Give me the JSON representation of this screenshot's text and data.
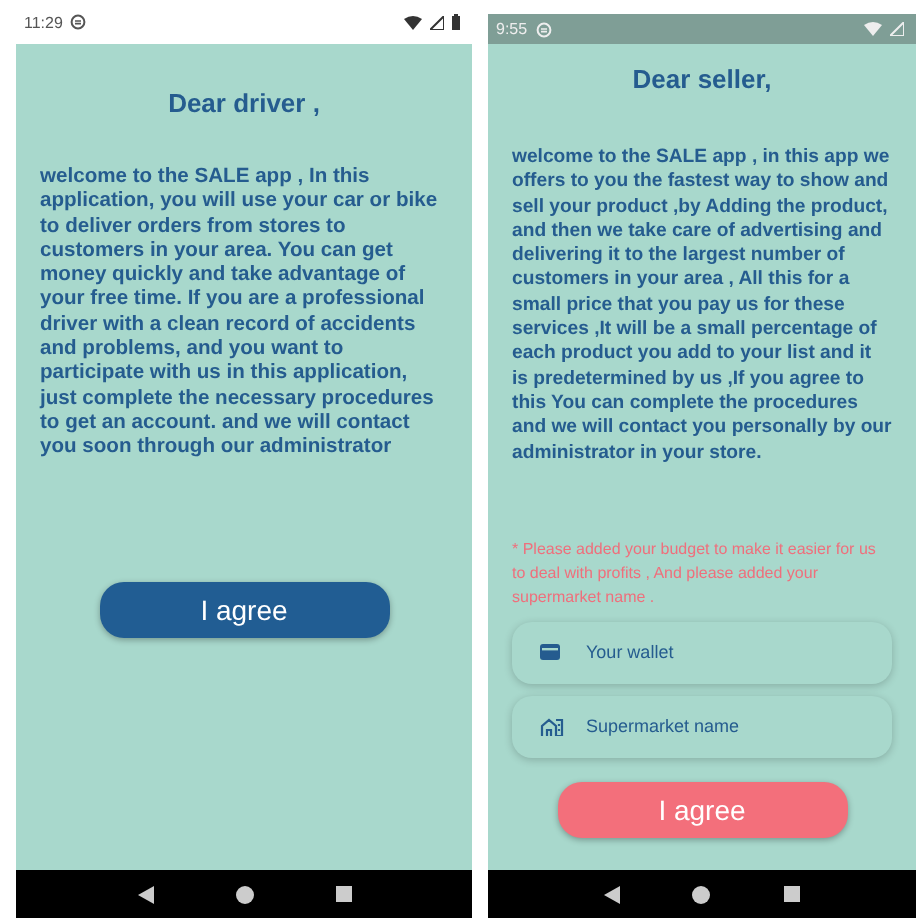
{
  "screens": [
    {
      "kind": "driver",
      "status_bar": {
        "time": "11:29"
      },
      "title": "Dear driver ,",
      "body": "welcome to the SALE app , In this application, you will use your car or bike to deliver orders from stores to customers in your area. You can get money quickly and take advantage of your free time. If you are a professional driver with a clean record of accidents and problems, and you want to participate with us in this application, just complete the necessary procedures to get an account. and we will contact you soon through our administrator",
      "button": "I agree"
    },
    {
      "kind": "seller",
      "status_bar": {
        "time": "9:55"
      },
      "title": "Dear seller,",
      "body": "welcome to the SALE app , in this app we offers to you the fastest way to show and sell your product ,by Adding the product, and then we take care of advertising and delivering it to the largest number of customers in your area , All this for a small price that you pay us for these services ,It will be a small percentage of each product you add to your list and it is predetermined by us ,If you agree to this You can complete the procedures and we will contact you personally by our administrator in your store.",
      "note": "* Please added your budget to make it easier for us to deal with profits , And please added your supermarket name .",
      "fields": [
        {
          "kind": "wallet",
          "placeholder": "Your wallet"
        },
        {
          "kind": "store",
          "placeholder": "Supermarket name"
        }
      ],
      "button": "I agree"
    }
  ]
}
